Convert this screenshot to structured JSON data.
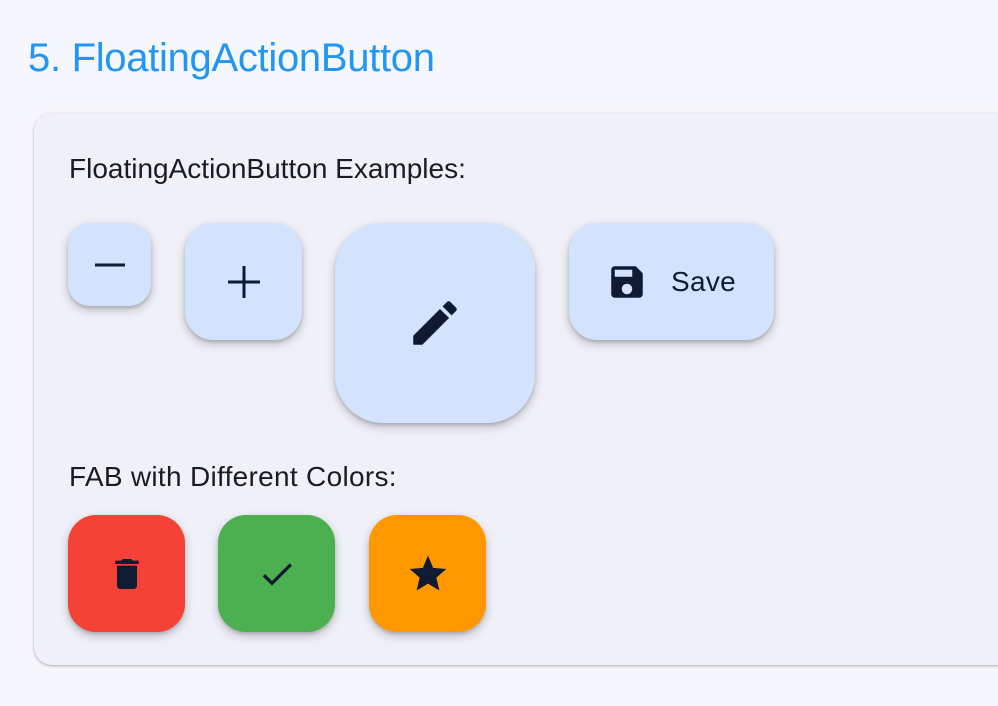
{
  "page": {
    "title": "5. FloatingActionButton"
  },
  "card": {
    "examples_label": "FloatingActionButton Examples:",
    "colors_label": "FAB with Different Colors:"
  },
  "fabs": {
    "small": {
      "icon": "remove-icon",
      "color": "#d3e3fd"
    },
    "regular": {
      "icon": "add-icon",
      "color": "#d3e3fd"
    },
    "large": {
      "icon": "edit-icon",
      "color": "#d3e3fd"
    },
    "extended": {
      "icon": "save-icon",
      "label": "Save",
      "color": "#d3e3fd"
    }
  },
  "colored_fabs": [
    {
      "icon": "delete-icon",
      "color": "#f44336"
    },
    {
      "icon": "check-icon",
      "color": "#4caf50"
    },
    {
      "icon": "star-icon",
      "color": "#ff9800"
    }
  ],
  "colors": {
    "title": "#2196f3",
    "icon": "#0e1b33",
    "card_bg": "#f0f1f8",
    "page_bg": "#f6f7fc"
  }
}
